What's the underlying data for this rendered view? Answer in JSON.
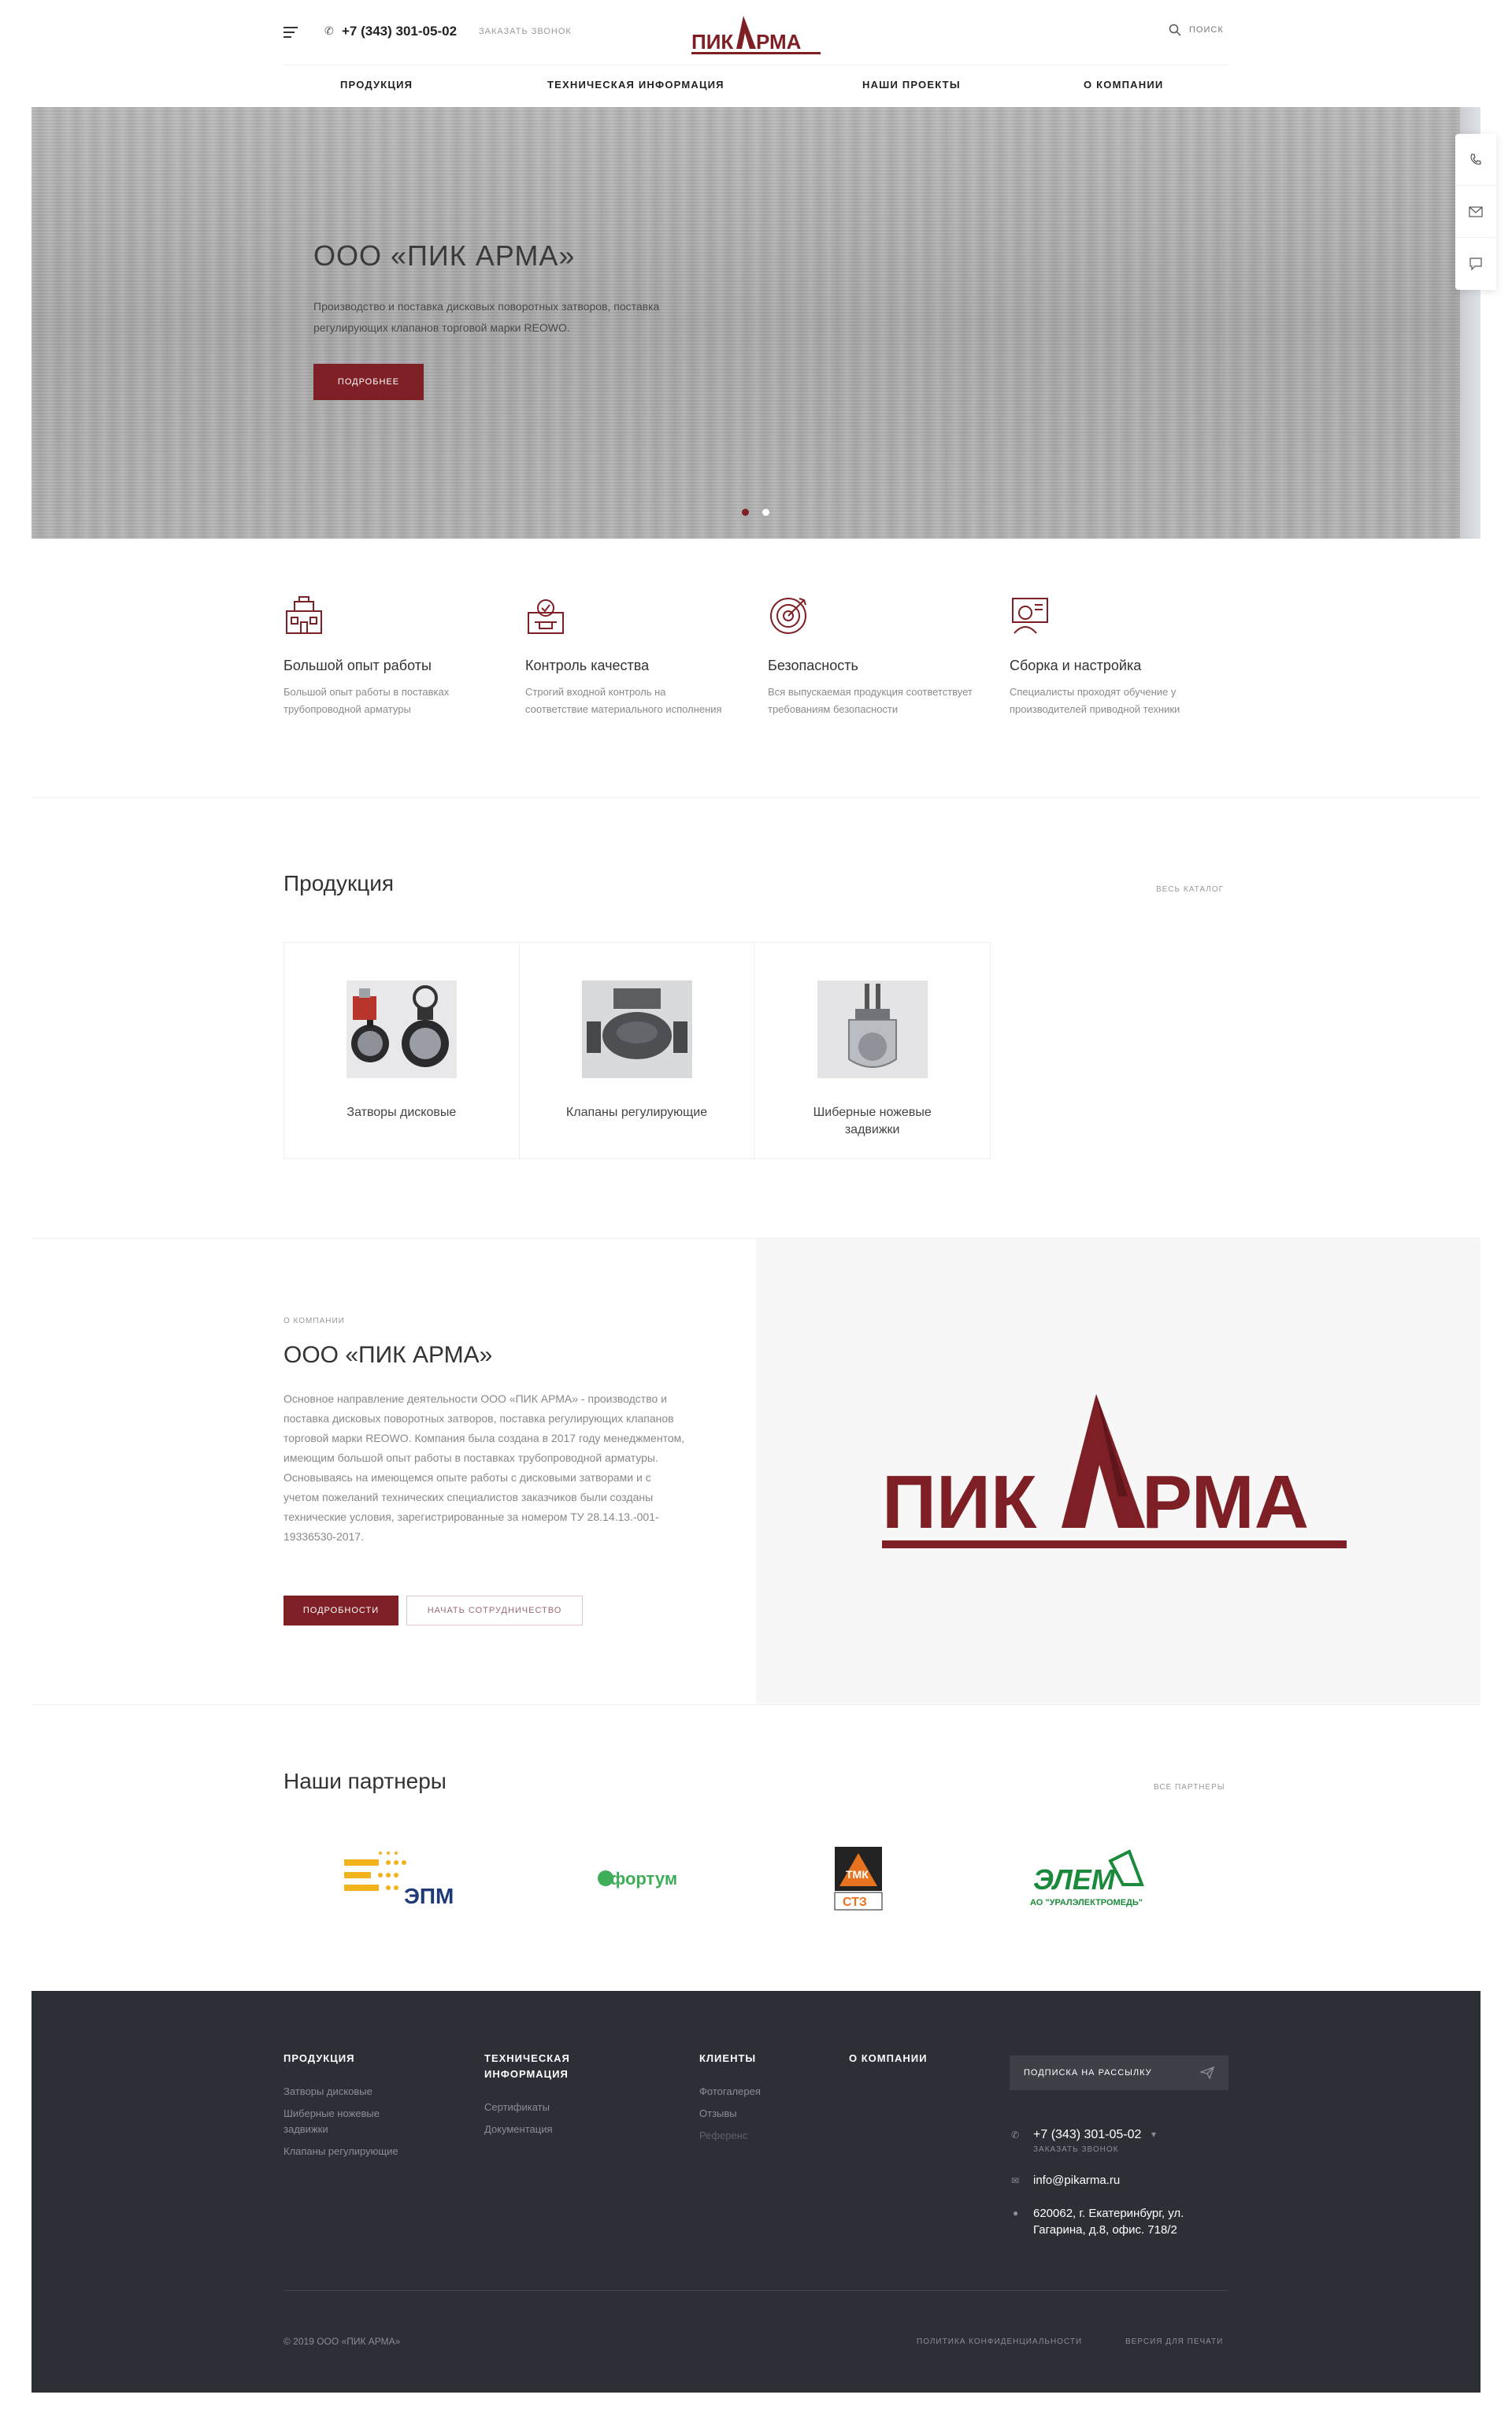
{
  "header": {
    "phone": "+7 (343) 301-05-02",
    "callback": "заказать звонок",
    "logo_text": "ПИКАРМА",
    "search": "поиск",
    "nav": [
      "Продукция",
      "Техническая информация",
      "Наши проекты",
      "О компании"
    ]
  },
  "hero": {
    "title": "ООО «ПИК АРМА»",
    "subtitle": "Производство и поставка дисковых поворотных затворов, поставка регулирующих клапанов торговой марки REOWO.",
    "button": "подробнее"
  },
  "features": [
    {
      "icon": "experience-icon",
      "title": "Большой опыт работы",
      "desc": "Большой опыт работы в поставках трубопроводной арматуры"
    },
    {
      "icon": "quality-icon",
      "title": "Контроль качества",
      "desc": "Строгий входной контроль на соответствие материального исполнения"
    },
    {
      "icon": "target-icon",
      "title": "Безопасность",
      "desc": "Вся выпускаемая продукция соответствует требованиям безопасности"
    },
    {
      "icon": "specialist-icon",
      "title": "Сборка и настройка",
      "desc": "Специалисты проходят обучение у производителей приводной техники"
    }
  ],
  "products": {
    "title": "Продукция",
    "link": "весь каталог",
    "items": [
      {
        "name": "Затворы дисковые"
      },
      {
        "name": "Клапаны регулирующие"
      },
      {
        "name": "Шиберные ножевые задвижки"
      }
    ]
  },
  "about": {
    "pre": "о компании",
    "title": "ООО «ПИК АРМА»",
    "text": "Основное направление деятельности ООО «ПИК АРМА» - производство и поставка дисковых поворотных затворов, поставка регулирующих клапанов торговой марки REOWO. Компания была создана в 2017 году менеджментом, имеющим большой опыт работы в поставках трубопроводной арматуры. Основываясь на имеющемся опыте работы с дисковыми затворами и с учетом пожеланий технических специалистов заказчиков были созданы технические условия, зарегистрированные за номером ТУ 28.14.13.-001-19336530-2017.",
    "btn_details": "подробности",
    "btn_cooperate": "начать сотрудничество",
    "logo_text": "ПИКАРМА"
  },
  "partners": {
    "title": "Наши партнеры",
    "link": "все партнеры",
    "items": [
      {
        "name": "ЭПМ"
      },
      {
        "name": "фортум"
      },
      {
        "name": "ТМК",
        "sub": "СТЗ"
      },
      {
        "name": "ЭЛЕМ",
        "sub": "АО \"УРАЛЭЛЕКТРОМЕДЬ\""
      }
    ]
  },
  "footer": {
    "col1_title": "Продукция",
    "col1": [
      "Затворы дисковые",
      "Шиберные ножевые",
      "задвижки",
      "Клапаны регулирующие"
    ],
    "col2_title_1": "Техническая",
    "col2_title_2": "информация",
    "col2": [
      "Сертификаты",
      "Документация"
    ],
    "col3_title": "Клиенты",
    "col3": [
      "Фотогалерея",
      "Отзывы",
      "Референс"
    ],
    "col4_title": "О компании",
    "subscribe": "подписка на рассылку",
    "phone": "+7 (343) 301-05-02",
    "callback": "заказать звонок",
    "email": "info@pikarma.ru",
    "address": "620062, г. Екатеринбург, ул. Гагарина, д.8, офис. 718/2",
    "copyright": "© 2019 ООО «ПИК АРМА»",
    "privacy": "политика конфиденциальности",
    "print": "версия для печати"
  },
  "colors": {
    "brand": "#7d1f25",
    "footer_bg": "#2c2f35"
  }
}
